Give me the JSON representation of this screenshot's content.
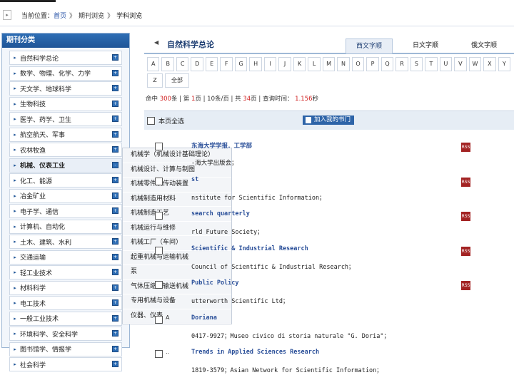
{
  "breadcrumb": {
    "prefix": "当前位置：",
    "home": "首页",
    "sep1": "》",
    "section": "期刊浏览",
    "sep2": "》",
    "current": "学科浏览"
  },
  "sidebar": {
    "title": "期刊分类",
    "items": [
      {
        "label": "自然科学总论",
        "bullet": "▸",
        "expand": "+"
      },
      {
        "label": "数学、物理、化学、力学",
        "bullet": "▸",
        "expand": "+"
      },
      {
        "label": "天文学、地球科学",
        "bullet": "▸",
        "expand": "+"
      },
      {
        "label": "生物科技",
        "bullet": "▸",
        "expand": "+"
      },
      {
        "label": "医学、药学、卫生",
        "bullet": "▸",
        "expand": "+"
      },
      {
        "label": "航空航天、军事",
        "bullet": "▸",
        "expand": "+"
      },
      {
        "label": "农林牧渔",
        "bullet": "▸",
        "expand": "+"
      },
      {
        "label": "机械、仪表工业",
        "bullet": "▸",
        "expand": "-"
      },
      {
        "label": "化工、能源",
        "bullet": "▸",
        "expand": "+"
      },
      {
        "label": "冶金矿业",
        "bullet": "▸",
        "expand": "+"
      },
      {
        "label": "电子学、通信",
        "bullet": "▸",
        "expand": "+"
      },
      {
        "label": "计算机、自动化",
        "bullet": "▸",
        "expand": "+"
      },
      {
        "label": "土木、建筑、水利",
        "bullet": "▸",
        "expand": "+"
      },
      {
        "label": "交通运输",
        "bullet": "▸",
        "expand": "+"
      },
      {
        "label": "轻工业技术",
        "bullet": "▸",
        "expand": "+"
      },
      {
        "label": "材料科学",
        "bullet": "▸",
        "expand": "+"
      },
      {
        "label": "电工技术",
        "bullet": "▸",
        "expand": "+"
      },
      {
        "label": "一般工业技术",
        "bullet": "▸",
        "expand": "+"
      },
      {
        "label": "环境科学、安全科学",
        "bullet": "▸",
        "expand": "+"
      },
      {
        "label": "图书馆学、情报学",
        "bullet": "▸",
        "expand": "+"
      },
      {
        "label": "社会科学",
        "bullet": "▸",
        "expand": "+"
      }
    ],
    "submenu": [
      "机械学（机械设计基础理论）",
      "机械设计、计算与制图",
      "机械零件及传动装置",
      "机械制造用材料",
      "机械制造工艺",
      "机械运行与维修",
      "机械工厂（车间）",
      "起重机械与运输机械",
      "泵",
      "气体压缩与输送机械",
      "专用机械与设备",
      "仪器、仪表"
    ]
  },
  "main": {
    "pin": "◀",
    "title": "自然科学总论",
    "tabs": [
      "西文字顺",
      "日文字顺",
      "俄文字顺"
    ],
    "alpha_row1": [
      "A",
      "B",
      "C",
      "D",
      "E",
      "F",
      "G",
      "H",
      "I",
      "J",
      "K",
      "L",
      "M",
      "N",
      "O",
      "P",
      "Q",
      "R",
      "S",
      "T",
      "U",
      "V",
      "W",
      "X",
      "Y"
    ],
    "alpha_row2": [
      "Z",
      "全部"
    ],
    "stats": {
      "prefix": "命中",
      "hits": "300",
      "hits_suffix": "条",
      "page_label": "| 第",
      "page": "1",
      "page_suffix": "页 |",
      "per_page": "10条/页",
      "total_label": "| 共",
      "total_pages": "34",
      "total_suffix": "页 |",
      "time_label": "查询时间：",
      "time_value": "1.156",
      "time_suffix": "秒"
    },
    "select_all": "本页全选",
    "add_button": "加入我的书门",
    "results": [
      {
        "num": "",
        "title": "东海大学学报．工学部",
        "pub": "-海大学出版会；",
        "rss": "RSS"
      },
      {
        "num": "",
        "title": "st",
        "pub": "nstitute for Scientific Information；",
        "rss": "RSS"
      },
      {
        "num": "",
        "title": "search quarterly",
        "pub": "rld Future Society；",
        "rss": "RSS"
      },
      {
        "num": "",
        "title": "Scientific & Industrial Research",
        "pub": "Council of Scientific & Industrial Research；",
        "rss": "RSS"
      },
      {
        "num": "",
        "title": "Public Policy",
        "pub": "utterworth Scientific Ltd；",
        "rss": "RSS"
      },
      {
        "num": "A",
        "title": "Doriana",
        "pub": "0417-9927；Museo civico di storia naturale \"G. Doria\"；",
        "rss": ""
      },
      {
        "num": "..",
        "title": "Trends in Applied Sciences Research",
        "pub": "1819-3579；Asian Network for Scientific Information；",
        "rss": ""
      }
    ]
  }
}
